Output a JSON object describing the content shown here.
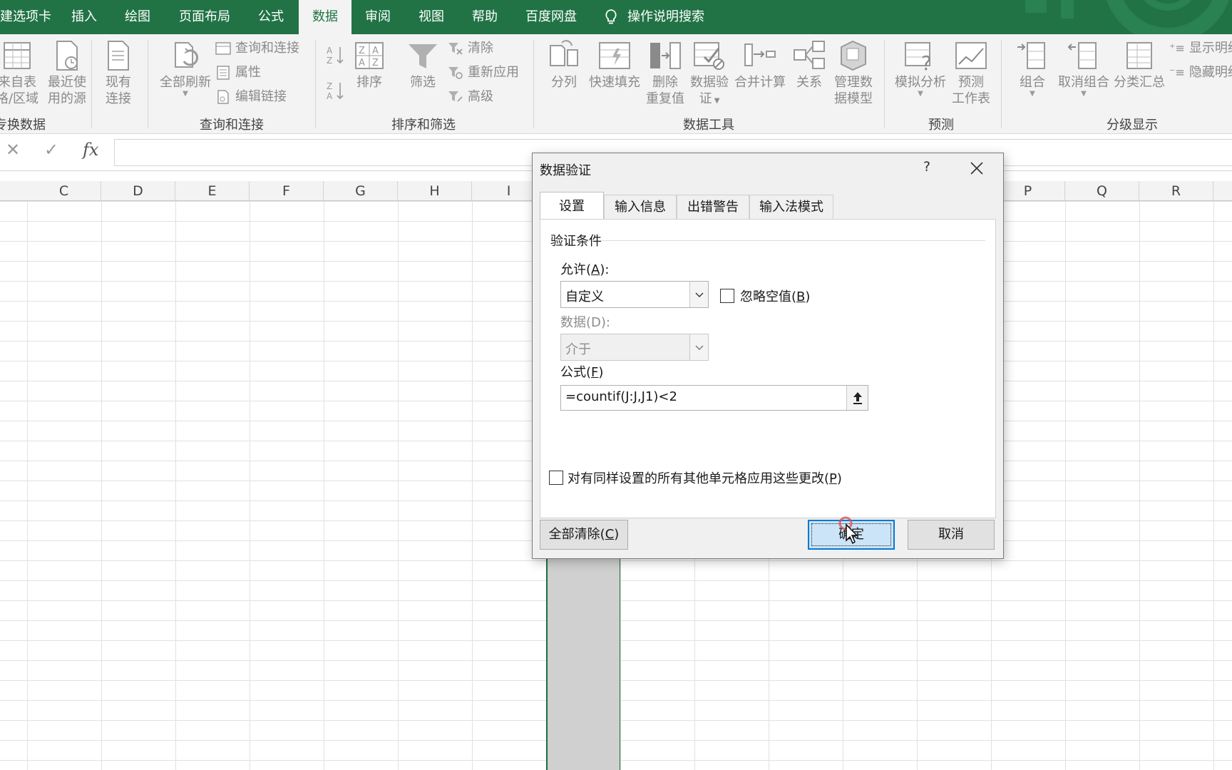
{
  "ribbon_tabs": [
    {
      "label": "建选项卡"
    },
    {
      "label": "插入"
    },
    {
      "label": "绘图"
    },
    {
      "label": "页面布局"
    },
    {
      "label": "公式"
    },
    {
      "label": "数据"
    },
    {
      "label": "审阅"
    },
    {
      "label": "视图"
    },
    {
      "label": "帮助"
    },
    {
      "label": "百度网盘"
    }
  ],
  "tell_me": "操作说明搜索",
  "ribbon": {
    "get_data": {
      "btn1": [
        "来自表",
        "格/区域"
      ],
      "btn2": [
        "最近使",
        "用的源"
      ],
      "btn3": [
        "现有",
        "连接"
      ],
      "group": "专换数据"
    },
    "queries": {
      "refresh": "全部刷新",
      "query_conn": "查询和连接",
      "props": "属性",
      "edit_links": "编辑链接",
      "group": "查询和连接"
    },
    "sort_filter": {
      "sort": "排序",
      "filter": "筛选",
      "clear": "清除",
      "reapply": "重新应用",
      "advanced": "高级",
      "group": "排序和筛选"
    },
    "data_tools": {
      "split": "分列",
      "flash": "快速填充",
      "dup": [
        "删除",
        "重复值"
      ],
      "validate": [
        "数据验",
        "证"
      ],
      "consolidate": "合并计算",
      "relations": "关系",
      "model": [
        "管理数",
        "据模型"
      ],
      "group": "数据工具"
    },
    "forecast": {
      "whatif": "模拟分析",
      "sheet": [
        "预测",
        "工作表"
      ],
      "group": "预测"
    },
    "outline": {
      "group_btn": "组合",
      "ungroup": "取消组合",
      "subtotal": "分类汇总",
      "show": "显示明细",
      "hide": "隐藏明细",
      "group": "分级显示"
    }
  },
  "formula_bar": {
    "cancel": "✕",
    "enter": "✓",
    "fx": "fx"
  },
  "columns": [
    "C",
    "D",
    "E",
    "F",
    "G",
    "H",
    "I",
    "P",
    "Q",
    "R"
  ],
  "dialog": {
    "title": "数据验证",
    "help": "?",
    "tabs": [
      "设置",
      "输入信息",
      "出错警告",
      "输入法模式"
    ],
    "section": "验证条件",
    "allow_label_pre": "允许(",
    "allow_key": "A",
    "allow_label_post": "):",
    "allow_value": "自定义",
    "ignore_blank_pre": "忽略空值(",
    "ignore_blank_key": "B",
    "ignore_blank_post": ")",
    "ignore_blank_checked": false,
    "data_label": "数据(D):",
    "data_value": "介于",
    "formula_label_pre": "公式(",
    "formula_key": "F",
    "formula_label_post": ")",
    "formula_value": "=countif(J:J,J1)<2",
    "apply_all_pre": "对有同样设置的所有其他单元格应用这些更改(",
    "apply_all_key": "P",
    "apply_all_post": ")",
    "apply_all_checked": false,
    "clear_all_pre": "全部清除(",
    "clear_all_key": "C",
    "clear_all_post": ")",
    "ok": "确定",
    "cancel": "取消"
  }
}
